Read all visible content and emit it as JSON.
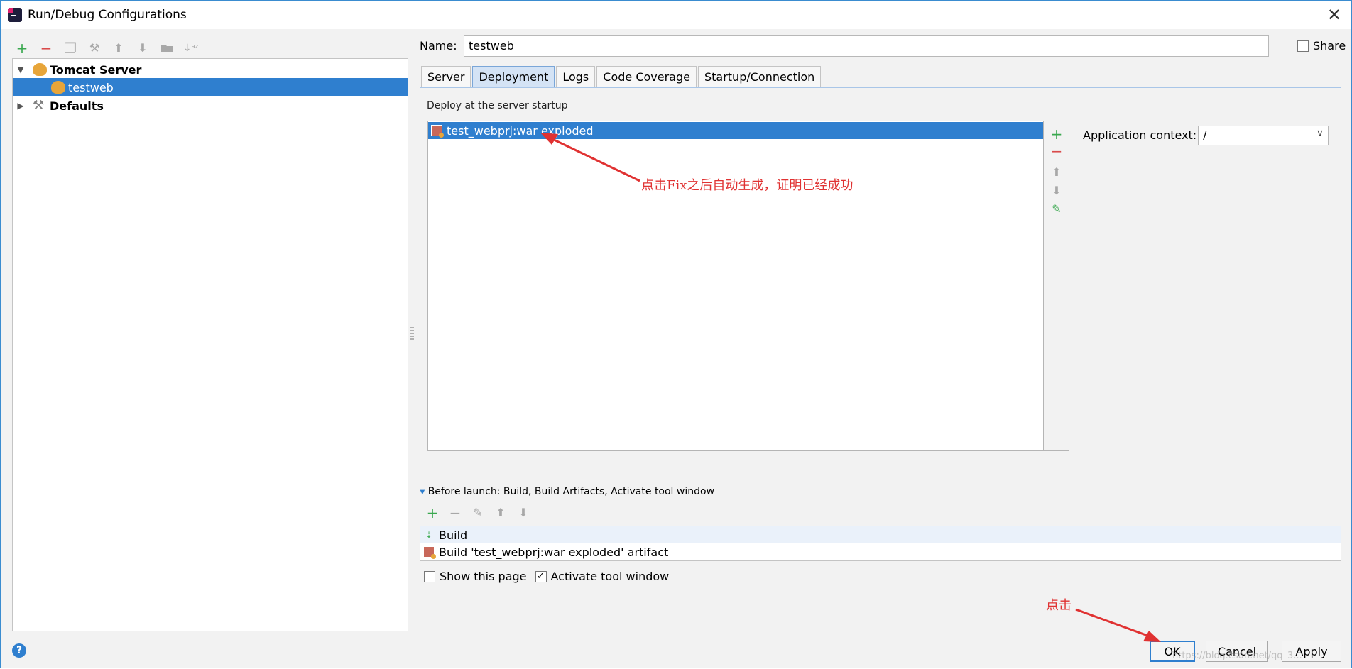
{
  "window": {
    "title": "Run/Debug Configurations",
    "close": "✕"
  },
  "left_toolbar": [
    {
      "icon": "plus-icon",
      "glyph": "+"
    },
    {
      "icon": "minus-icon",
      "glyph": "−"
    },
    {
      "icon": "copy-icon",
      "glyph": "❐"
    },
    {
      "icon": "wrench-icon",
      "glyph": "🔧"
    },
    {
      "icon": "arrow-up-icon",
      "glyph": "⬆"
    },
    {
      "icon": "arrow-down-icon",
      "glyph": "⬇"
    },
    {
      "icon": "folder-icon",
      "glyph": "▬"
    },
    {
      "icon": "sort-icon",
      "glyph": "↓ᵃᶻ"
    }
  ],
  "tree": {
    "group": "Tomcat Server",
    "child": "testweb",
    "defaults": "Defaults"
  },
  "name": {
    "label": "Name:",
    "value": "testweb"
  },
  "share": {
    "label": "Share",
    "checked": false
  },
  "tabs": [
    "Server",
    "Deployment",
    "Logs",
    "Code Coverage",
    "Startup/Connection"
  ],
  "active_tab": "Deployment",
  "deploy": {
    "section_title": "Deploy at the server startup",
    "items": [
      "test_webprj:war exploded"
    ]
  },
  "context": {
    "label": "Application context:",
    "value": "/"
  },
  "annotations": {
    "deploy_note": "点击Fix之后自动生成，证明已经成功",
    "click_note": "点击"
  },
  "before_launch": {
    "title": "Before launch: Build, Build Artifacts, Activate tool window",
    "items": [
      "Build",
      "Build 'test_webprj:war exploded' artifact"
    ]
  },
  "options": {
    "show_this_page": {
      "label": "Show this page",
      "checked": false
    },
    "activate_tool_window": {
      "label": "Activate tool window",
      "checked": true
    }
  },
  "buttons": {
    "ok": "OK",
    "cancel": "Cancel",
    "apply": "Apply"
  },
  "help": "?",
  "watermark": "https://blog.csdn.net/qq_3..."
}
